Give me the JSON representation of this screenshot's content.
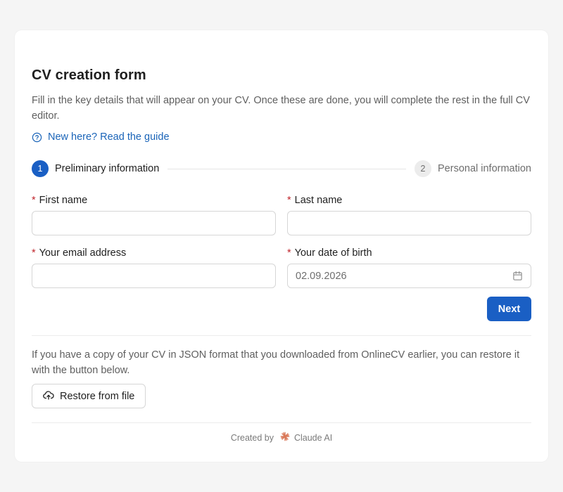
{
  "form": {
    "title": "CV creation form",
    "intro": "Fill in the key details that will appear on your CV. Once these are done, you will complete the rest in the full CV editor.",
    "guide_link": "New here? Read the guide"
  },
  "steps": [
    {
      "number": "1",
      "label": "Preliminary information",
      "state": "active"
    },
    {
      "number": "2",
      "label": "Personal information",
      "state": "inactive"
    }
  ],
  "fields": {
    "first_name": {
      "required_mark": "*",
      "label": "First name",
      "value": ""
    },
    "last_name": {
      "required_mark": "*",
      "label": "Last name",
      "value": ""
    },
    "email": {
      "required_mark": "*",
      "label": "Your email address",
      "value": ""
    },
    "dob": {
      "required_mark": "*",
      "label": "Your date of birth",
      "value": "02.09.2026"
    }
  },
  "actions": {
    "next_label": "Next",
    "restore_text": "If you have a copy of your CV in JSON format that you downloaded from OnlineCV earlier, you can restore it with the button below.",
    "restore_label": "Restore from file"
  },
  "footer": {
    "created_by": "Created by",
    "brand": "Claude AI"
  },
  "icons": {
    "guide": "help-circle-icon",
    "calendar": "calendar-icon",
    "upload": "cloud-upload-icon",
    "brand": "claude-logo-icon"
  },
  "colors": {
    "primary": "#1a5fc4",
    "link": "#1a64b8",
    "required": "#c0262d",
    "brand": "#d97757",
    "background": "#f5f5f5",
    "card": "#ffffff"
  }
}
